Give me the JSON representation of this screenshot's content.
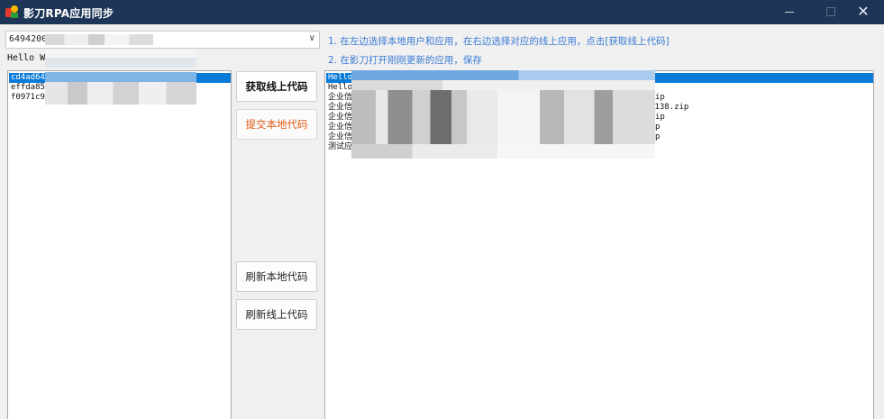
{
  "window": {
    "title": "影刀RPA应用同步",
    "min_symbol": "—",
    "max_symbol": "☐",
    "close_symbol": "✕"
  },
  "account_select": {
    "value": "6494200",
    "arrow": "∨"
  },
  "hello_label": "Hello W",
  "instructions": {
    "step1": "1. 在左边选择本地用户和应用，在右边选择对应的线上应用，点击[获取线上代码]",
    "step2": "2. 在影刀打开刚刚更新的应用，保存"
  },
  "local_list": [
    {
      "text": "cd4ad64",
      "selected": true
    },
    {
      "text": "effda85",
      "selected": false
    },
    {
      "text": "f0971c9",
      "selected": false
    }
  ],
  "online_list": [
    {
      "text": "Hello",
      "tail": "",
      "selected": true
    },
    {
      "text": "Hello",
      "tail": "",
      "selected": false
    },
    {
      "text": "企业信",
      "tail": "ip",
      "selected": false
    },
    {
      "text": "企业信",
      "tail": "3138.zip",
      "selected": false
    },
    {
      "text": "企业信",
      "tail": "ip",
      "selected": false
    },
    {
      "text": "企业信",
      "tail": "p",
      "selected": false
    },
    {
      "text": "企业信",
      "tail": "p",
      "selected": false
    },
    {
      "text": "测试应",
      "tail": "",
      "selected": false
    }
  ],
  "buttons": {
    "fetch_online": "获取线上代码",
    "submit_local": "提交本地代码",
    "refresh_local": "刷新本地代码",
    "refresh_online": "刷新线上代码"
  },
  "colors": {
    "titlebar": "#1d3556",
    "selection": "#0a7bd8",
    "instruction_text": "#3a7bd5",
    "submit_text": "#e05a14"
  }
}
